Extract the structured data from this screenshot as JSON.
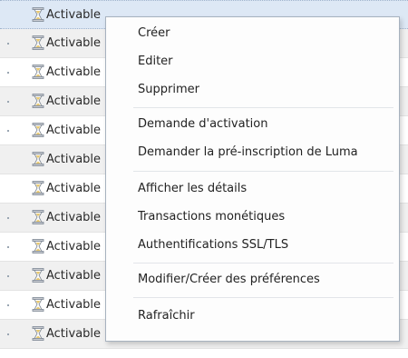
{
  "rows": [
    {
      "status": "Activable"
    },
    {
      "status": "Activable"
    },
    {
      "status": "Activable"
    },
    {
      "status": "Activable"
    },
    {
      "status": "Activable"
    },
    {
      "status": "Activable"
    },
    {
      "status": "Activable"
    },
    {
      "status": "Activable"
    },
    {
      "status": "Activable"
    },
    {
      "status": "Activable"
    },
    {
      "status": "Activable"
    },
    {
      "status": "Activable",
      "cols": [
        "-",
        "-",
        "-"
      ]
    }
  ],
  "context_menu": {
    "groups": [
      [
        "Créer",
        "Editer",
        "Supprimer"
      ],
      [
        "Demande d'activation",
        "Demander la pré-inscription de Luma"
      ],
      [
        "Afficher les détails",
        "Transactions monétiques",
        "Authentifications SSL/TLS"
      ],
      [
        "Modifier/Créer des préférences"
      ],
      [
        "Rafraîchir"
      ]
    ]
  }
}
